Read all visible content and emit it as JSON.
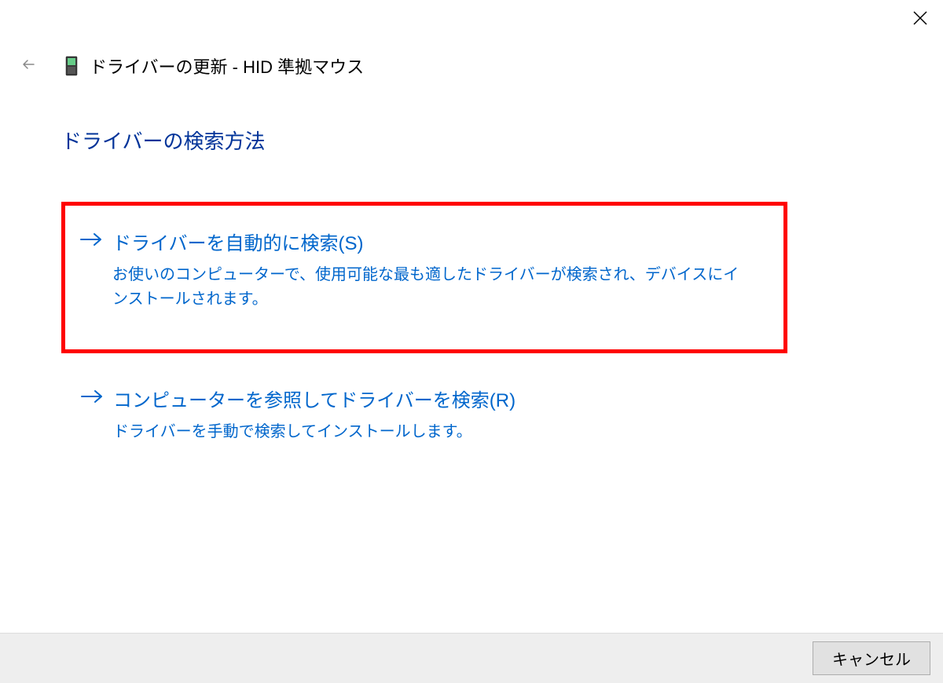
{
  "header": {
    "title": "ドライバーの更新 - HID 準拠マウス"
  },
  "content": {
    "heading": "ドライバーの検索方法",
    "options": [
      {
        "title": "ドライバーを自動的に検索(S)",
        "description": "お使いのコンピューターで、使用可能な最も適したドライバーが検索され、デバイスにインストールされます。"
      },
      {
        "title": "コンピューターを参照してドライバーを検索(R)",
        "description": "ドライバーを手動で検索してインストールします。"
      }
    ]
  },
  "footer": {
    "cancel_label": "キャンセル"
  }
}
